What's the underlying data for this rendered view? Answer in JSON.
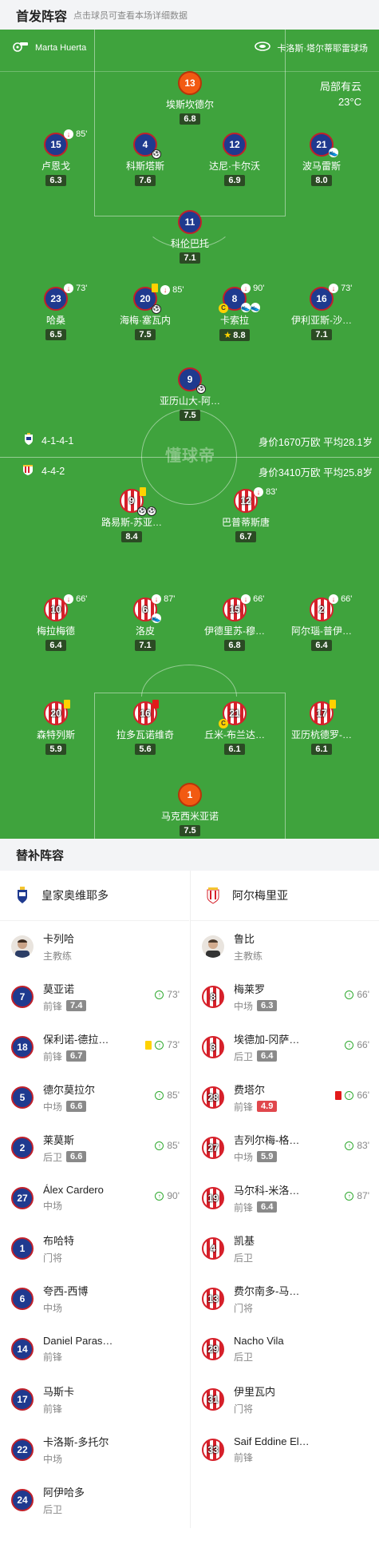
{
  "header": {
    "title": "首发阵容",
    "subtitle": "点击球员可查看本场详细数据"
  },
  "pitch": {
    "home_coach_label": "Marta Huerta",
    "stadium": "卡洛斯·塔尔蒂耶雷球场",
    "weather_line1": "局部有云",
    "weather_line2": "23°C",
    "watermark": "懂球帝",
    "home_formation": "4-1-4-1",
    "home_info": "身价1670万欧 平均28.1岁",
    "away_formation": "4-4-2",
    "away_info": "身价3410万欧 平均25.8岁"
  },
  "home_players": [
    {
      "num": "13",
      "name": "埃斯坎德尔",
      "rating": "6.8"
    },
    {
      "num": "15",
      "name": "卢恩戈",
      "rating": "6.3",
      "ev": "85'"
    },
    {
      "num": "4",
      "name": "科斯塔斯",
      "rating": "7.6"
    },
    {
      "num": "12",
      "name": "达尼·卡尔沃",
      "rating": "6.9"
    },
    {
      "num": "21",
      "name": "波马雷斯",
      "rating": "8.0"
    },
    {
      "num": "11",
      "name": "科伦巴托",
      "rating": "7.1"
    },
    {
      "num": "23",
      "name": "哈桑",
      "rating": "6.5",
      "ev": "73'"
    },
    {
      "num": "20",
      "name": "海梅·塞瓦内",
      "rating": "7.5",
      "ev": "85'"
    },
    {
      "num": "8",
      "name": "卡索拉",
      "rating": "8.8",
      "ev": "90'"
    },
    {
      "num": "16",
      "name": "伊利亚斯-沙…",
      "rating": "7.1",
      "ev": "73'"
    },
    {
      "num": "9",
      "name": "亚历山大-阿…",
      "rating": "7.5"
    }
  ],
  "away_players": [
    {
      "num": "9",
      "name": "路易斯-苏亚…",
      "rating": "8.4"
    },
    {
      "num": "12",
      "name": "巴普蒂斯唐",
      "rating": "6.7",
      "ev": "83'"
    },
    {
      "num": "10",
      "name": "梅拉梅德",
      "rating": "6.4",
      "ev": "66'"
    },
    {
      "num": "6",
      "name": "洛皮",
      "rating": "7.1",
      "ev": "87'"
    },
    {
      "num": "15",
      "name": "伊德里苏-穆…",
      "rating": "6.8",
      "ev": "66'"
    },
    {
      "num": "2",
      "name": "阿尔瑙-普伊…",
      "rating": "6.4",
      "ev": "66'"
    },
    {
      "num": "20",
      "name": "森特列斯",
      "rating": "5.9"
    },
    {
      "num": "16",
      "name": "拉多瓦诺维奇",
      "rating": "5.6"
    },
    {
      "num": "21",
      "name": "丘米-布兰达…",
      "rating": "6.1"
    },
    {
      "num": "17",
      "name": "亚历杭德罗-…",
      "rating": "6.1"
    },
    {
      "num": "1",
      "name": "马克西米亚诺",
      "rating": "7.5"
    }
  ],
  "subs_title": "替补阵容",
  "home_team": "皇家奥维耶多",
  "away_team": "阿尔梅里亚",
  "home_coach": {
    "name": "卡列哈",
    "role": "主教练"
  },
  "away_coach": {
    "name": "鲁比",
    "role": "主教练"
  },
  "home_subs": [
    {
      "num": "7",
      "name": "莫亚诺",
      "pos": "前锋",
      "rating": "7.4",
      "ev": "73'"
    },
    {
      "num": "18",
      "name": "保利诺-德拉…",
      "pos": "前锋",
      "rating": "6.7",
      "ev": "73'"
    },
    {
      "num": "5",
      "name": "德尔莫拉尔",
      "pos": "中场",
      "rating": "6.6",
      "ev": "85'"
    },
    {
      "num": "2",
      "name": "莱莫斯",
      "pos": "后卫",
      "rating": "6.6",
      "ev": "85'"
    },
    {
      "num": "27",
      "name": "Álex Cardero",
      "pos": "中场",
      "ev": "90'"
    },
    {
      "num": "1",
      "name": "布哈特",
      "pos": "门将"
    },
    {
      "num": "6",
      "name": "夸西-西博",
      "pos": "中场"
    },
    {
      "num": "14",
      "name": "Daniel Paras…",
      "pos": "前锋"
    },
    {
      "num": "17",
      "name": "马斯卡",
      "pos": "前锋"
    },
    {
      "num": "22",
      "name": "卡洛斯-多托尔",
      "pos": "中场"
    },
    {
      "num": "24",
      "name": "阿伊哈多",
      "pos": "后卫"
    }
  ],
  "away_subs": [
    {
      "num": "8",
      "name": "梅莱罗",
      "pos": "中场",
      "rating": "6.3",
      "ev": "66'"
    },
    {
      "num": "3",
      "name": "埃德加-冈萨…",
      "pos": "后卫",
      "rating": "6.4",
      "ev": "66'"
    },
    {
      "num": "28",
      "name": "费塔尔",
      "pos": "前锋",
      "rating": "4.9",
      "ev": "66'"
    },
    {
      "num": "27",
      "name": "吉列尔梅-格…",
      "pos": "中场",
      "rating": "5.9",
      "ev": "83'"
    },
    {
      "num": "19",
      "name": "马尔科-米洛…",
      "pos": "前锋",
      "rating": "6.4",
      "ev": "87'"
    },
    {
      "num": "4",
      "name": "凯基",
      "pos": "后卫"
    },
    {
      "num": "13",
      "name": "费尔南多-马…",
      "pos": "门将"
    },
    {
      "num": "29",
      "name": "Nacho Vila",
      "pos": "后卫"
    },
    {
      "num": "31",
      "name": "伊里瓦内",
      "pos": "门将"
    },
    {
      "num": "33",
      "name": "Saif Eddine El…",
      "pos": "前锋"
    }
  ]
}
